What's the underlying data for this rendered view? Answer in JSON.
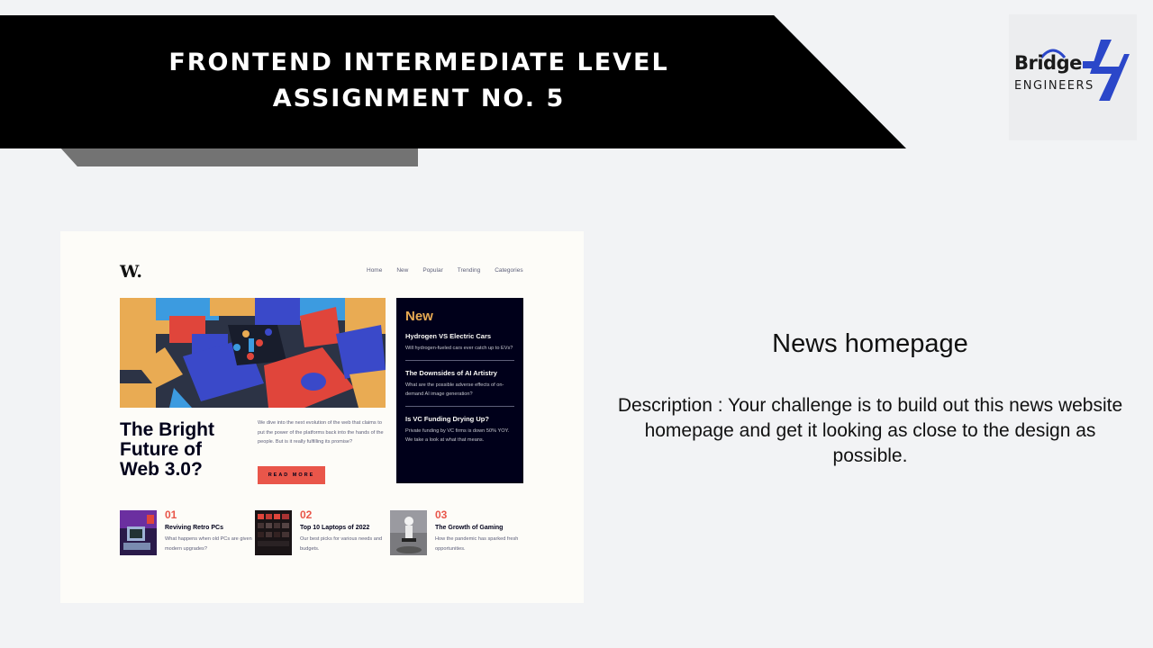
{
  "banner": {
    "line1": "FRONTEND INTERMEDIATE LEVEL",
    "line2": "ASSIGNMENT NO. 5"
  },
  "logo": {
    "brand": "Bridge",
    "sub": "ENGINEERS",
    "accent": "#2b47c9"
  },
  "preview": {
    "logo": "W.",
    "nav": [
      "Home",
      "New",
      "Popular",
      "Trending",
      "Categories"
    ],
    "headline": "The Bright Future of Web 3.0?",
    "description": "We dive into the next evolution of the web that claims to put the power of the platforms back into the hands of the people. But is it really fulfilling its promise?",
    "read_more": "READ MORE",
    "new_section": {
      "title": "New",
      "items": [
        {
          "title": "Hydrogen VS Electric Cars",
          "desc": "Will hydrogen-fueled cars ever catch up to EVs?"
        },
        {
          "title": "The Downsides of AI Artistry",
          "desc": "What are the possible adverse effects of on-demand AI image generation?"
        },
        {
          "title": "Is VC Funding Drying Up?",
          "desc": "Private funding by VC firms is down 50% YOY. We take a look at what that means."
        }
      ]
    },
    "articles": [
      {
        "num": "01",
        "title": "Reviving Retro PCs",
        "desc": "What happens when old PCs are given modern upgrades?"
      },
      {
        "num": "02",
        "title": "Top 10 Laptops of 2022",
        "desc": "Our best picks for various needs and budgets."
      },
      {
        "num": "03",
        "title": "The Growth of Gaming",
        "desc": "How the pandemic has sparked fresh opportunities."
      }
    ]
  },
  "right": {
    "title": "News homepage",
    "description": "Description : Your challenge is to build out this news website homepage and get it looking as close to the design as possible."
  }
}
